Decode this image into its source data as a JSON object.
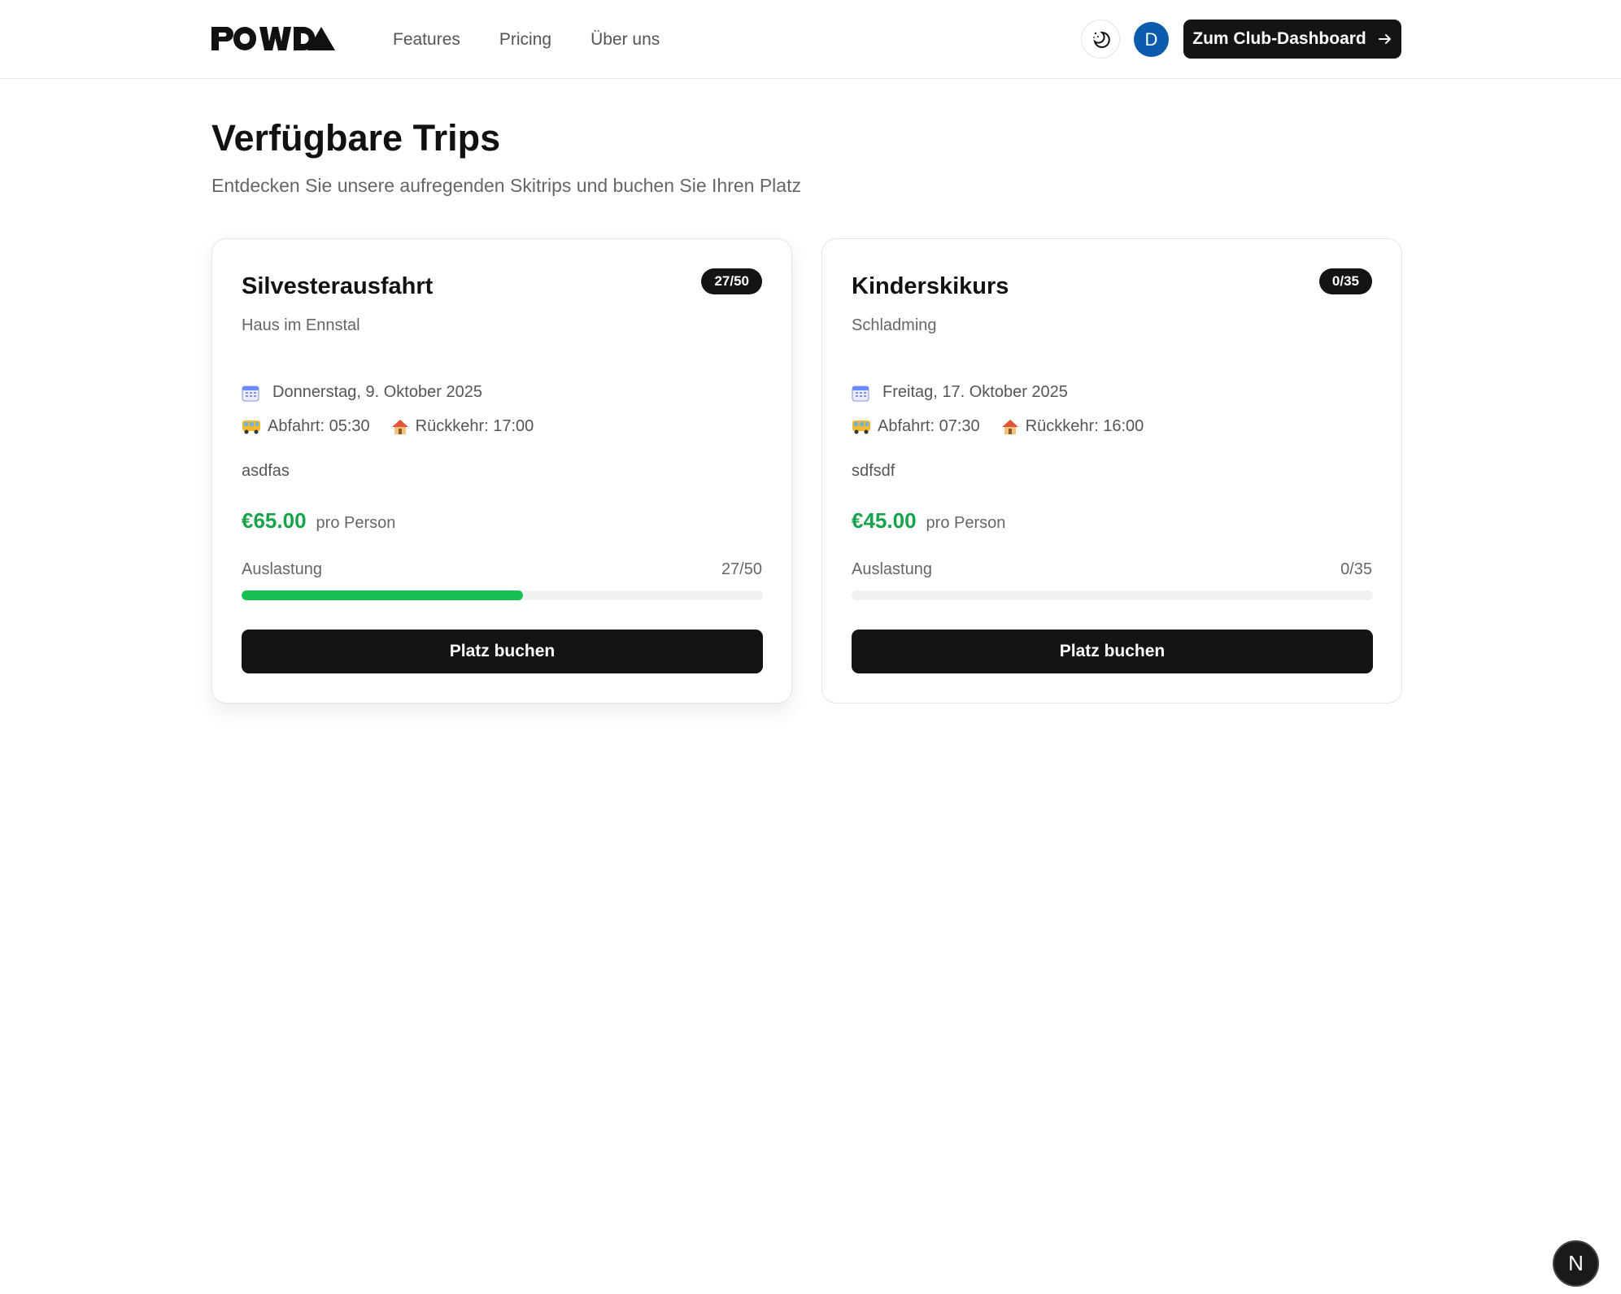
{
  "header": {
    "logo_text": "POWDA",
    "nav": [
      "Features",
      "Pricing",
      "Über uns"
    ],
    "theme_icon": "moon-icon",
    "avatar_initial": "D",
    "dashboard_button": "Zum Club-Dashboard",
    "dashboard_icon": "arrow-right-icon"
  },
  "page": {
    "title": "Verfügbare Trips",
    "subtitle": "Entdecken Sie unsere aufregenden Skitrips und buchen Sie Ihren Platz"
  },
  "trips": [
    {
      "title": "Silvesterausfahrt",
      "badge": "27/50",
      "location": "Haus im Ennstal",
      "date": "Donnerstag, 9. Oktober 2025",
      "departure": "Abfahrt: 05:30",
      "return": "Rückkehr: 17:00",
      "description": "asdfas",
      "price": "€65.00",
      "price_unit": "pro Person",
      "load_label": "Auslastung",
      "load_value": "27/50",
      "load_fraction": 0.54,
      "button": "Platz buchen"
    },
    {
      "title": "Kinderskikurs",
      "badge": "0/35",
      "location": "Schladming",
      "date": "Freitag, 17. Oktober 2025",
      "departure": "Abfahrt: 07:30",
      "return": "Rückkehr: 16:00",
      "description": "sdfsdf",
      "price": "€45.00",
      "price_unit": "pro Person",
      "load_label": "Auslastung",
      "load_value": "0/35",
      "load_fraction": 0,
      "button": "Platz buchen"
    }
  ],
  "dev_badge": "N",
  "colors": {
    "price": "#16a34a",
    "progress": "#15c153",
    "avatar": "#0b5cad",
    "button": "#141414"
  }
}
